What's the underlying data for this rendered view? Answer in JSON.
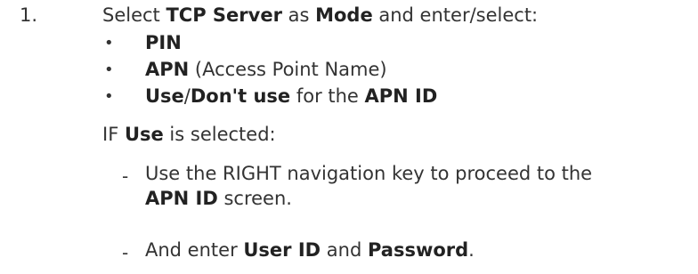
{
  "step": {
    "number": "1.",
    "intro": {
      "t1": "Select ",
      "b1": "TCP Server",
      "t2": " as ",
      "b2": "Mode",
      "t3": " and enter/select:"
    },
    "bullets": [
      {
        "bold": "PIN",
        "rest": ""
      },
      {
        "bold": "APN",
        "rest": " (Access Point Name)"
      },
      {
        "b1": "Use",
        "sep": "/",
        "b2": "Don't use",
        "mid": " for the ",
        "b3": "APN ID"
      }
    ],
    "bullet_char": "•",
    "condition": {
      "prefix": "IF ",
      "bold": "Use",
      "suffix": " is selected:"
    },
    "dash_char": "-",
    "substeps": [
      {
        "line1": "Use the RIGHT navigation key to proceed to the",
        "line2_bold": "APN ID",
        "line2_rest": " screen."
      },
      {
        "t1": "And enter ",
        "b1": "User ID",
        "t2": " and ",
        "b2": "Password",
        "t3": "."
      }
    ]
  }
}
